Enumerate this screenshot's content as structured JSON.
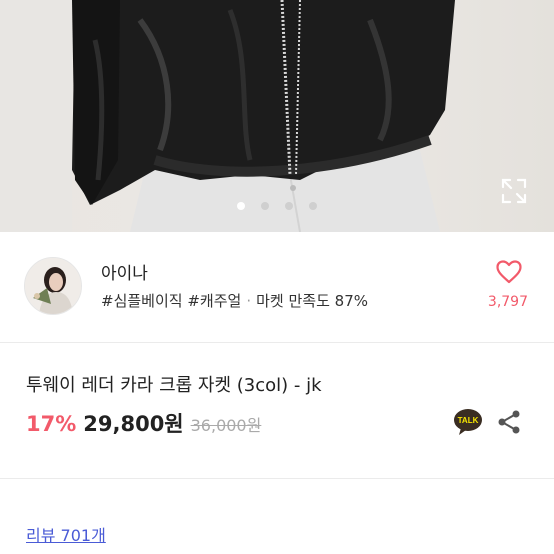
{
  "gallery": {
    "image_alt": "black leather jacket product photo",
    "slide_count": 4,
    "active_slide": 1,
    "expand_icon": "expand-icon"
  },
  "seller": {
    "name": "아이나",
    "tags": [
      "#심플베이직",
      "#캐주얼"
    ],
    "satisfaction": "마켓 만족도 87%",
    "avatar_icon": "avatar",
    "like_icon": "heart-icon",
    "like_count": "3,797",
    "like_color": "#f25a6a"
  },
  "product": {
    "title": "투웨이 레더 카라 크롭 자켓 (3col) - jk",
    "discount": "17%",
    "price": "29,800원",
    "original_price": "36,000원",
    "talk_icon": "kakao-talk-icon",
    "talk_label": "TALK",
    "share_icon": "share-icon"
  },
  "reviews": {
    "link_label": "리뷰 701개"
  }
}
